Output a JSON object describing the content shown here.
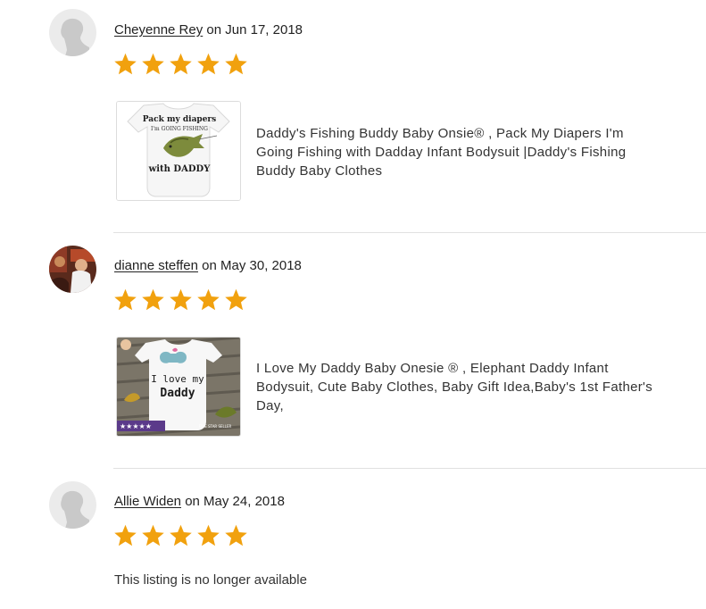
{
  "reviews": [
    {
      "reviewer": "Cheyenne Rey",
      "date_text": "on Jun 17, 2018",
      "rating": 5,
      "avatar": "default-person-icon",
      "listing": {
        "title": "Daddy's Fishing Buddy Baby Onsie® , Pack My Diapers I'm Going Fishing with Dadday Infant Bodysuit |Daddy's Fishing Buddy Baby Clothes",
        "thumb_text": [
          "Pack my diapers",
          "I'm GOING FISHING",
          "with DADDY"
        ]
      }
    },
    {
      "reviewer": "dianne steffen",
      "date_text": "on May 30, 2018",
      "rating": 5,
      "avatar": "user-photo",
      "listing": {
        "title": "I Love My Daddy Baby Onesie ® , Elephant Daddy Infant Bodysuit, Cute Baby Clothes, Baby Gift Idea,Baby's 1st Father's Day,",
        "thumb_text": [
          "I love my",
          "Daddy",
          "★★★★★",
          "FIVE STAR SELLER"
        ]
      }
    },
    {
      "reviewer": "Allie Widen",
      "date_text": "on May 24, 2018",
      "rating": 5,
      "avatar": "default-person-icon",
      "unavailable_text": "This listing is no longer available"
    }
  ],
  "colors": {
    "star": "#f1a10e",
    "divider": "#e1e1e1",
    "text": "#222222"
  }
}
